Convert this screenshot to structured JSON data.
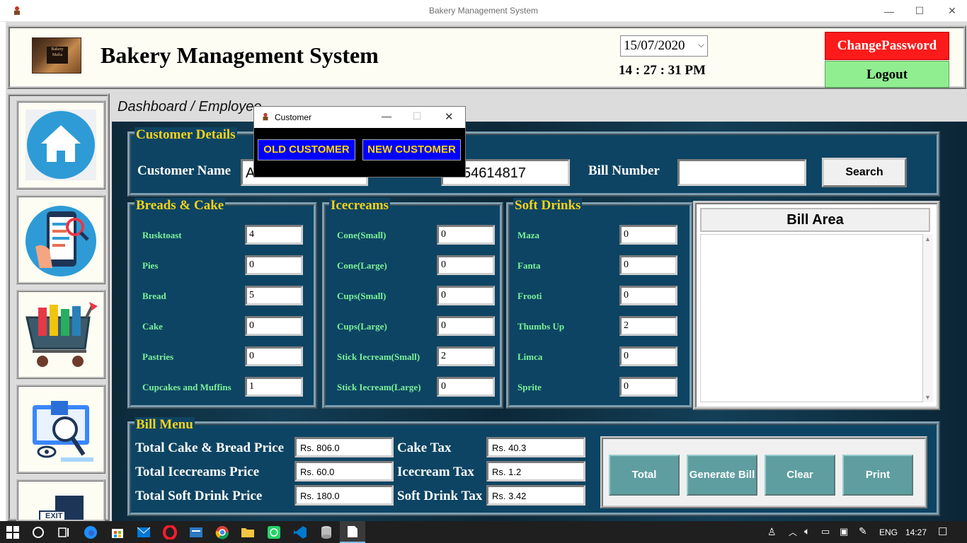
{
  "window": {
    "title": "Bakery Management System",
    "minimize": "—",
    "maximize": "☐",
    "close": "✕"
  },
  "header": {
    "logo_text": "Bakery Mafia",
    "title": "Bakery Management System",
    "date": "15/07/2020",
    "time": "14 : 27 : 31 PM",
    "change_password": "ChangePassword",
    "logout": "Logout"
  },
  "sidebar": {
    "items": [
      {
        "name": "home-icon"
      },
      {
        "name": "mobile-search-icon"
      },
      {
        "name": "shopping-cart-icon"
      },
      {
        "name": "inventory-monitor-icon"
      },
      {
        "name": "exit-icon",
        "label": "EXIT"
      }
    ]
  },
  "breadcrumb": "Dashboard / Employee",
  "customer": {
    "title": "Customer Details",
    "name_label": "Customer Name",
    "name_value": "A",
    "phone_value": "54614817",
    "bill_label": "Bill Number",
    "bill_value": "",
    "search": "Search"
  },
  "breads": {
    "title": "Breads & Cake",
    "items": [
      {
        "label": "Rusktoast",
        "value": "4"
      },
      {
        "label": "Pies",
        "value": "0"
      },
      {
        "label": "Bread",
        "value": "5"
      },
      {
        "label": "Cake",
        "value": "0"
      },
      {
        "label": "Pastries",
        "value": "0"
      },
      {
        "label": "Cupcakes and Muffins",
        "value": "1"
      }
    ]
  },
  "icecreams": {
    "title": "Icecreams",
    "items": [
      {
        "label": "Cone(Small)",
        "value": "0"
      },
      {
        "label": "Cone(Large)",
        "value": "0"
      },
      {
        "label": "Cups(Small)",
        "value": "0"
      },
      {
        "label": "Cups(Large)",
        "value": "0"
      },
      {
        "label": "Stick Iecream(Small)",
        "value": "2"
      },
      {
        "label": "Stick Iecream(Large)",
        "value": "0"
      }
    ]
  },
  "drinks": {
    "title": "Soft Drinks",
    "items": [
      {
        "label": "Maza",
        "value": "0"
      },
      {
        "label": "Fanta",
        "value": "0"
      },
      {
        "label": "Frooti",
        "value": "0"
      },
      {
        "label": "Thumbs Up",
        "value": "2"
      },
      {
        "label": "Limca",
        "value": "0"
      },
      {
        "label": "Sprite",
        "value": "0"
      }
    ]
  },
  "bill_area": {
    "title": "Bill Area",
    "text": ""
  },
  "bill_menu": {
    "title": "Bill Menu",
    "rows": [
      {
        "price_label": "Total Cake & Bread Price",
        "price_value": "Rs. 806.0",
        "tax_label": "Cake Tax",
        "tax_value": "Rs. 40.3"
      },
      {
        "price_label": "Total Icecreams Price",
        "price_value": "Rs. 60.0",
        "tax_label": "Icecream Tax",
        "tax_value": "Rs. 1.2"
      },
      {
        "price_label": "Total Soft Drink Price",
        "price_value": "Rs. 180.0",
        "tax_label": "Soft Drink Tax",
        "tax_value": "Rs. 3.42"
      }
    ],
    "buttons": {
      "total": "Total",
      "generate": "Generate Bill",
      "clear": "Clear",
      "print": "Print"
    }
  },
  "dialog": {
    "title": "Customer",
    "old": "OLD CUSTOMER",
    "new": "NEW CUSTOMER"
  },
  "taskbar": {
    "lang": "ENG",
    "time": "14:27"
  },
  "colors": {
    "panel": "#0d4463",
    "accent_yellow": "#f4d21a",
    "field_label_green": "#7cf29a",
    "button_teal": "#5f9ea0",
    "change_password_red": "#fd1a1a",
    "logout_green": "#90ee90",
    "dialog_blue": "#0000fe"
  }
}
